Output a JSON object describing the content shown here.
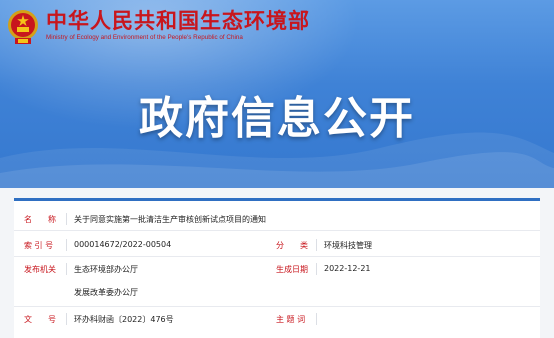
{
  "header": {
    "ministry_cn": "中华人民共和国生态环境部",
    "ministry_en": "Ministry of Ecology and Environment of the People's Republic of China",
    "banner_title": "政府信息公开",
    "emblem_icon": "national-emblem-icon",
    "accent_red": "#c8161d",
    "banner_blue": "#3f82d6"
  },
  "meta": {
    "name_label": "名　　称",
    "name_value": "关于同意实施第一批清洁生产审核创新试点项目的通知",
    "index_label": "索 引 号",
    "index_value": "000014672/2022-00504",
    "category_label": "分　　类",
    "category_value": "环境科技管理",
    "issuer_label": "发布机关",
    "issuer_value_1": "生态环境部办公厅",
    "issuer_value_2": "发展改革委办公厅",
    "date_label": "生成日期",
    "date_value": "2022-12-21",
    "docno_label": "文　　号",
    "docno_value": "环办科财函〔2022〕476号",
    "subject_label": "主 题 词",
    "subject_value": ""
  }
}
